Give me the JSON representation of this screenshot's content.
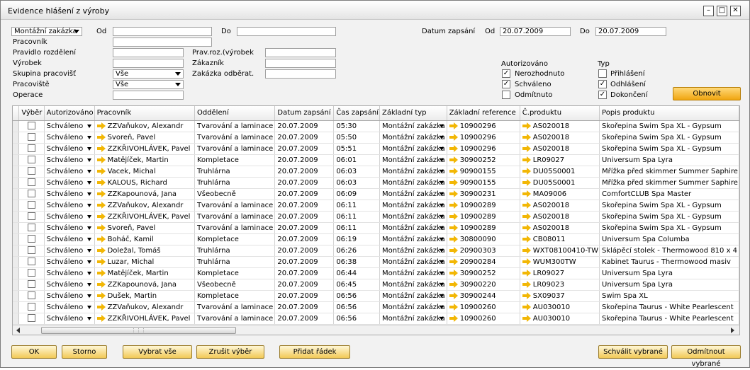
{
  "window": {
    "title": "Evidence hlášení z výroby"
  },
  "filters": {
    "type_select": "Montážní zakázka",
    "od_label": "Od",
    "do_label": "Do",
    "od_value": "",
    "do_value": "",
    "pracovnik_label": "Pracovník",
    "pravidlo_label": "Pravidlo rozdělení",
    "vyrobek_label": "Výrobek",
    "skupina_label": "Skupina pracovišť",
    "skupina_value": "Vše",
    "pracoviste_label": "Pracoviště",
    "pracoviste_value": "Vše",
    "operace_label": "Operace",
    "prav_roz_label": "Prav.roz.(výrobek",
    "zakaznik_label": "Zákazník",
    "zakazka_label": "Zakázka odběrat.",
    "datum_label": "Datum zapsání",
    "datum_od_label": "Od",
    "datum_od": "20.07.2009",
    "datum_do_label": "Do",
    "datum_do": "20.07.2009",
    "autorizovano_label": "Autorizováno",
    "nerozhodnuto": "Nerozhodnuto",
    "schvaleno": "Schváleno",
    "odmitnuto": "Odmítnuto",
    "typ_label": "Typ",
    "prihlaseni": "Přihlášení",
    "odhlaseni": "Odhlášení",
    "dokonceni": "Dokončení",
    "obnovit": "Obnovit",
    "checks": {
      "nerozhodnuto": true,
      "schvaleno": true,
      "odmitnuto": false,
      "prihlaseni": false,
      "odhlaseni": true,
      "dokonceni": true
    }
  },
  "grid": {
    "columns": [
      "Výběr",
      "Autorizováno",
      "Pracovník",
      "Oddělení",
      "Datum zapsání",
      "Čas zapsání",
      "Základní typ",
      "Základní reference",
      "Č.produktu",
      "Popis produktu"
    ],
    "rows": [
      [
        "Schváleno",
        "ZZVaňukov, Alexandr",
        "Tvarování a laminace",
        "20.07.2009",
        "05:30",
        "Montážní zakázka",
        "10900296",
        "AS020018",
        "Skořepina Swim Spa XL - Gypsum"
      ],
      [
        "Schváleno",
        "Svoreň, Pavel",
        "Tvarování a laminace",
        "20.07.2009",
        "05:50",
        "Montážní zakázka",
        "10900296",
        "AS020018",
        "Skořepina Swim Spa XL - Gypsum"
      ],
      [
        "Schváleno",
        "ZZKŘIVOHLÁVEK, Pavel",
        "Tvarování a laminace",
        "20.07.2009",
        "05:51",
        "Montážní zakázka",
        "10900296",
        "AS020018",
        "Skořepina Swim Spa XL - Gypsum"
      ],
      [
        "Schváleno",
        "Matějíček, Martin",
        "Kompletace",
        "20.07.2009",
        "06:01",
        "Montážní zakázka",
        "30900252",
        "LR09027",
        "Universum Spa Lyra"
      ],
      [
        "Schváleno",
        "Vacek, Michal",
        "Truhlárna",
        "20.07.2009",
        "06:03",
        "Montážní zakázka",
        "90900155",
        "DU05S0001",
        "Mřížka před skimmer Summer Saphire"
      ],
      [
        "Schváleno",
        "KALOUS, Richard",
        "Truhlárna",
        "20.07.2009",
        "06:03",
        "Montážní zakázka",
        "90900155",
        "DU05S0001",
        "Mřížka před skimmer Summer Saphire"
      ],
      [
        "Schváleno",
        "ZZKapounová, Jana",
        "Všeobecně",
        "20.07.2009",
        "06:09",
        "Montážní zakázka",
        "30900231",
        "MA09006",
        "ComfortCLUB Spa Master"
      ],
      [
        "Schváleno",
        "ZZVaňukov, Alexandr",
        "Tvarování a laminace",
        "20.07.2009",
        "06:11",
        "Montážní zakázka",
        "10900289",
        "AS020018",
        "Skořepina Swim Spa XL - Gypsum"
      ],
      [
        "Schváleno",
        "ZZKŘIVOHLÁVEK, Pavel",
        "Tvarování a laminace",
        "20.07.2009",
        "06:11",
        "Montážní zakázka",
        "10900289",
        "AS020018",
        "Skořepina Swim Spa XL - Gypsum"
      ],
      [
        "Schváleno",
        "Svoreň, Pavel",
        "Tvarování a laminace",
        "20.07.2009",
        "06:11",
        "Montážní zakázka",
        "10900289",
        "AS020018",
        "Skořepina Swim Spa XL - Gypsum"
      ],
      [
        "Schváleno",
        "Boháč, Kamil",
        "Kompletace",
        "20.07.2009",
        "06:19",
        "Montážní zakázka",
        "30800090",
        "CB08011",
        "Universum Spa Columba"
      ],
      [
        "Schváleno",
        "Doležal, Tomáš",
        "Truhlárna",
        "20.07.2009",
        "06:26",
        "Montážní zakázka",
        "20900303",
        "WXT08100410-TW",
        "Sklápěcí stolek - Thermowood 810 x 4"
      ],
      [
        "Schváleno",
        "Luzar, Michal",
        "Truhlárna",
        "20.07.2009",
        "06:38",
        "Montážní zakázka",
        "20900284",
        "WUM300TW",
        "Kabinet Taurus - Thermowood masiv"
      ],
      [
        "Schváleno",
        "Matějíček, Martin",
        "Kompletace",
        "20.07.2009",
        "06:44",
        "Montážní zakázka",
        "30900252",
        "LR09027",
        "Universum Spa Lyra"
      ],
      [
        "Schváleno",
        "ZZKapounová, Jana",
        "Všeobecně",
        "20.07.2009",
        "06:45",
        "Montážní zakázka",
        "30900220",
        "LR09023",
        "Universum Spa Lyra"
      ],
      [
        "Schváleno",
        "Dušek, Martin",
        "Kompletace",
        "20.07.2009",
        "06:56",
        "Montážní zakázka",
        "30900244",
        "SX09037",
        "Swim Spa XL"
      ],
      [
        "Schváleno",
        "ZZVaňukov, Alexandr",
        "Tvarování a laminace",
        "20.07.2009",
        "06:56",
        "Montážní zakázka",
        "10900260",
        "AU030010",
        "Skořepina Taurus - White Pearlescent"
      ],
      [
        "Schváleno",
        "ZZKŘIVOHLÁVEK, Pavel",
        "Tvarování a laminace",
        "20.07.2009",
        "06:56",
        "Montážní zakázka",
        "10900260",
        "AU030010",
        "Skořepina Taurus - White Pearlescent"
      ]
    ]
  },
  "footer": {
    "ok": "OK",
    "storno": "Storno",
    "vybrat_vse": "Vybrat vše",
    "zrusit_vyber": "Zrušit výběr",
    "pridat_radek": "Přidat řádek",
    "schvalit": "Schválit vybrané",
    "odmitnout": "Odmítnout vybrané"
  }
}
